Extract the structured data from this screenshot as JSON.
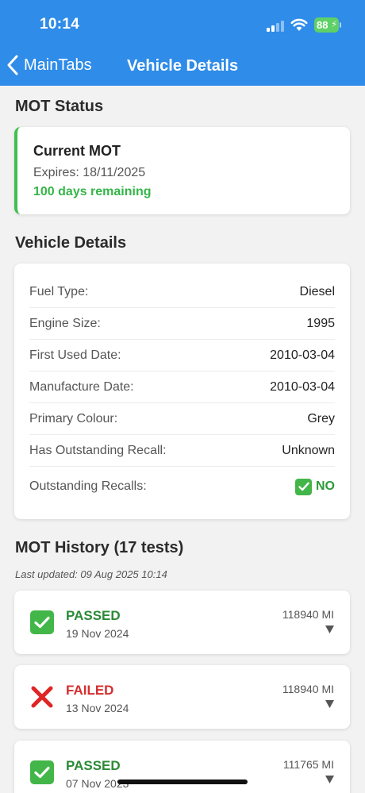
{
  "status_bar": {
    "time": "10:14",
    "battery": "88"
  },
  "nav": {
    "back_label": "MainTabs",
    "title": "Vehicle Details"
  },
  "mot_status": {
    "section_title": "MOT Status",
    "card_title": "Current MOT",
    "expires": "Expires: 18/11/2025",
    "remaining": "100 days remaining",
    "accent_color": "#3fbf50"
  },
  "vehicle_details": {
    "section_title": "Vehicle Details",
    "rows": [
      {
        "label": "Fuel Type:",
        "value": "Diesel"
      },
      {
        "label": "Engine Size:",
        "value": "1995"
      },
      {
        "label": "First Used Date:",
        "value": "2010-03-04"
      },
      {
        "label": "Manufacture Date:",
        "value": "2010-03-04"
      },
      {
        "label": "Primary Colour:",
        "value": "Grey"
      },
      {
        "label": "Has Outstanding Recall:",
        "value": "Unknown"
      },
      {
        "label": "Outstanding Recalls:",
        "value": "NO"
      }
    ]
  },
  "mot_history": {
    "section_title": "MOT History (17 tests)",
    "last_updated": "Last updated: 09 Aug 2025 10:14",
    "tests": [
      {
        "result": "PASSED",
        "date": "19 Nov 2024",
        "mileage": "118940 MI",
        "icon": "check-icon"
      },
      {
        "result": "FAILED",
        "date": "13 Nov 2024",
        "mileage": "118940 MI",
        "icon": "cross-icon"
      },
      {
        "result": "PASSED",
        "date": "07 Nov 2023",
        "mileage": "111765 MI",
        "icon": "check-icon"
      }
    ]
  },
  "colors": {
    "header": "#2f8ce8",
    "pass": "#2c8a37",
    "fail": "#d32f2f",
    "remaining": "#35b548"
  }
}
